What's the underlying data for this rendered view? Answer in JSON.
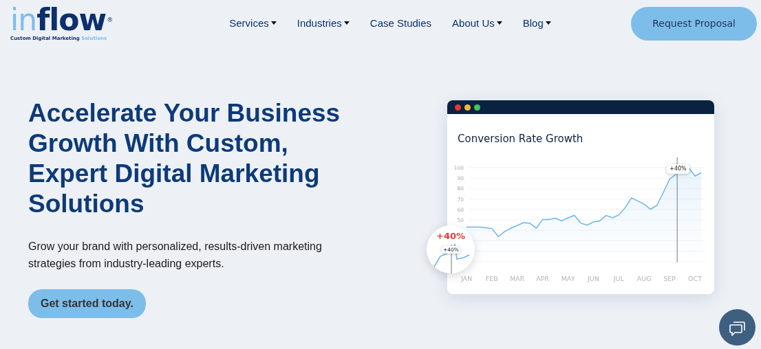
{
  "header": {
    "logo": {
      "part_1": "in",
      "part_2": "flow",
      "mark": "®"
    },
    "tagline": {
      "part_1": "Custom Digital Marketing",
      "part_2": "Solutions"
    },
    "nav_items": [
      {
        "label": "Services",
        "has_dropdown": true
      },
      {
        "label": "Industries",
        "has_dropdown": true
      },
      {
        "label": "Case Studies",
        "has_dropdown": false
      },
      {
        "label": "About Us",
        "has_dropdown": true
      },
      {
        "label": "Blog",
        "has_dropdown": true
      }
    ],
    "cta_button": "Request Proposal"
  },
  "hero": {
    "heading": "Accelerate Your Business Growth With Custom, Expert Digital Marketing Solutions",
    "subtitle": "Grow your brand with personalized, results-driven marketing strategies from industry-leading experts.",
    "button": "Get started today."
  },
  "chart_card": {
    "title": "Conversion Rate Growth",
    "chart_data": {
      "type": "area",
      "grid": true,
      "ylim": [
        10,
        100
      ],
      "yticks": [
        50,
        60,
        70,
        80,
        90,
        100
      ],
      "categories": [
        "JAN",
        null,
        null,
        null,
        "FEB",
        null,
        null,
        null,
        "MAR",
        null,
        null,
        null,
        "APR",
        null,
        null,
        null,
        "MAY",
        null,
        null,
        null,
        "JUN",
        null,
        null,
        null,
        "JUL",
        null,
        null,
        null,
        "AUG",
        null,
        null,
        null,
        "SEP",
        null,
        null,
        null,
        "OCT",
        null
      ],
      "series": [
        {
          "color": "#6cb4e8",
          "values": [
            43,
            43,
            43,
            42.5,
            41.7,
            34,
            38.7,
            42,
            44.6,
            47.3,
            46.7,
            42,
            50.4,
            50.4,
            51.6,
            49,
            52,
            54.3,
            47,
            45,
            48,
            49,
            54.2,
            52,
            54.7,
            61.6,
            71,
            68,
            65,
            60.2,
            63.8,
            76,
            88.9,
            93.6,
            null,
            100,
            92,
            95
          ]
        }
      ]
    },
    "marker_label": "+40%",
    "inset": {
      "headline": "+40%",
      "tip": "+40%"
    }
  }
}
